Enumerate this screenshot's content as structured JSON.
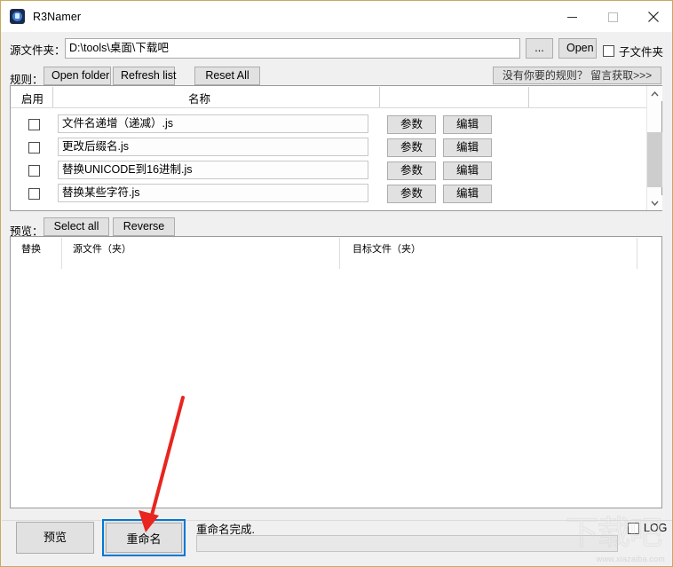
{
  "window": {
    "title": "R3Namer",
    "icon": "app-icon",
    "minimize_label": "—",
    "maximize_label": "□",
    "close_label": "✕"
  },
  "source": {
    "label": "源文件夹：",
    "path_value": "D:\\tools\\桌面\\下载吧",
    "path_placeholder": "",
    "browse_label": "...",
    "open_label": "Open",
    "subfolder_label": "子文件夹",
    "subfolder_checked": false
  },
  "rules_toolbar": {
    "label": "规则：",
    "open_folder_label": "Open folder",
    "refresh_list_label": "Refresh list",
    "reset_all_label": "Reset All",
    "ad_label": "没有你要的规则？ 留言获取>>>"
  },
  "rules_list": {
    "header": {
      "enable": "启用",
      "name": "名称"
    },
    "param_label": "参数",
    "edit_label": "编辑",
    "rows": [
      {
        "checked": false,
        "name": "文件名递增（递减）.js"
      },
      {
        "checked": false,
        "name": "更改后缀名.js"
      },
      {
        "checked": false,
        "name": "替换UNICODE到16进制.js"
      },
      {
        "checked": false,
        "name": "替换某些字符.js"
      }
    ]
  },
  "preview_toolbar": {
    "label": "预览：",
    "select_all_label": "Select all",
    "reverse_label": "Reverse"
  },
  "preview_table": {
    "columns": [
      "替换",
      "源文件（夹）",
      "目标文件（夹）"
    ],
    "rows": []
  },
  "bottom": {
    "preview_label": "预览",
    "rename_label": "重命名",
    "status_text": "重命名完成.",
    "status_field_value": "",
    "log_label": "LOG",
    "log_checked": false
  },
  "watermark": {
    "glyphs": "下载吧",
    "url": "www.xiazaiba.com"
  },
  "colors": {
    "window_border": "#c9a95f",
    "focus_blue": "#0078d7",
    "arrow_red": "#e8251f",
    "button_face": "#e1e1e1",
    "panel_bg": "#f0f0f0"
  }
}
